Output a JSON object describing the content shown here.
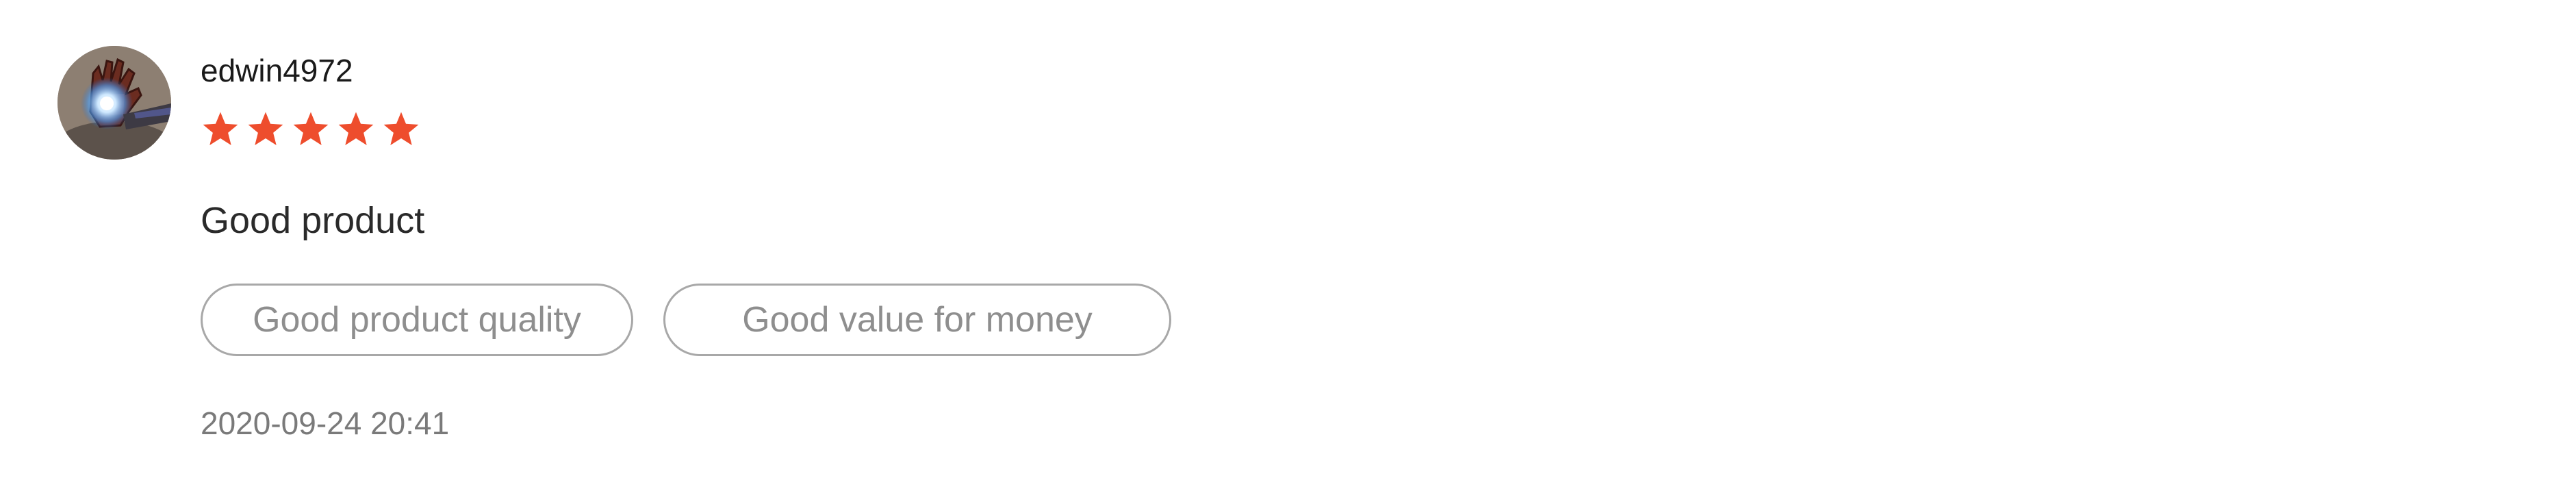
{
  "review": {
    "username": "edwin4972",
    "rating": 5,
    "rating_max": 5,
    "star_color": "#ee4d2d",
    "comment": "Good product",
    "tags": [
      {
        "label": "Good product quality"
      },
      {
        "label": "Good value for money"
      }
    ],
    "timestamp": "2020-09-24 20:41",
    "avatar_icon": "iron-man-hand-icon"
  }
}
